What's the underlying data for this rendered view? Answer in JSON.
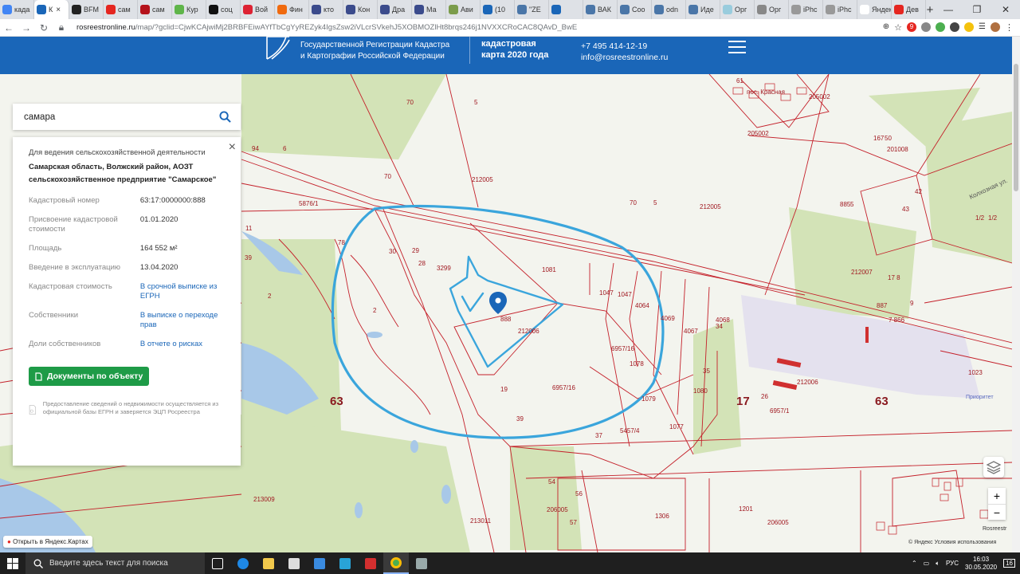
{
  "browser": {
    "tabs": [
      {
        "label": "када",
        "color": "#4285f4"
      },
      {
        "label": "К",
        "color": "#1a66b8",
        "active": true
      },
      {
        "label": "BFM",
        "color": "#222"
      },
      {
        "label": "сам",
        "color": "#e52620"
      },
      {
        "label": "сам",
        "color": "#b5121b"
      },
      {
        "label": "Кур",
        "color": "#5fb54a"
      },
      {
        "label": "соц",
        "color": "#111"
      },
      {
        "label": "Вой",
        "color": "#d23"
      },
      {
        "label": "Фин",
        "color": "#f06a0f"
      },
      {
        "label": "кто",
        "color": "#3b4b8c"
      },
      {
        "label": "Кон",
        "color": "#3b4b8c"
      },
      {
        "label": "Дра",
        "color": "#3b4b8c"
      },
      {
        "label": "Ма",
        "color": "#3b4b8c"
      },
      {
        "label": "Ави",
        "color": "#7b9c4b"
      },
      {
        "label": "(10",
        "color": "#1a66b8"
      },
      {
        "label": "\"ZE",
        "color": "#4a76a8"
      },
      {
        "label": "",
        "color": "#1a66b8"
      },
      {
        "label": "ВАК",
        "color": "#4a76a8"
      },
      {
        "label": "Coo",
        "color": "#4a76a8"
      },
      {
        "label": "odn",
        "color": "#4a76a8"
      },
      {
        "label": "Иде",
        "color": "#4a76a8"
      },
      {
        "label": "Орг",
        "color": "#9cd"
      },
      {
        "label": "Орг",
        "color": "#888"
      },
      {
        "label": "iPhc",
        "color": "#999"
      },
      {
        "label": "iPhc",
        "color": "#999"
      },
      {
        "label": "Яндекс",
        "color": "#fff"
      },
      {
        "label": "Дев",
        "color": "#e52620"
      }
    ],
    "new_tab": "+",
    "url_host": "rosreestronline.ru",
    "url_rest": "/map/?gclid=CjwKCAjwiMj2BRBFEiwAYfTbCgYyREZyk4IgsZsw2iVLcrSVkehJ5XOBMOZlHt8brqs246j1NVXXCRoCAC8QAvD_BwE",
    "badge": "9"
  },
  "header": {
    "org_line1": "Государственной Регистрации Кадастра",
    "org_line2": "и Картографии Российской Федерации",
    "map_line1": "кадастровая",
    "map_line2": "карта 2020 года",
    "phone": "+7 495 414-12-19",
    "email": "info@rosreestronline.ru"
  },
  "search": {
    "value": "самара"
  },
  "card": {
    "purpose": "Для ведения сельскохозяйственной деятельности",
    "address": "Самарская область, Волжский район, АОЗТ сельскохозяйственное предприятие \"Самарское\"",
    "rows": [
      {
        "k": "Кадастровый номер",
        "v": "63:17:0000000:888",
        "link": false
      },
      {
        "k": "Присвоение кадастровой стоимости",
        "v": "01.01.2020",
        "link": false
      },
      {
        "k": "Площадь",
        "v": "164 552 м²",
        "link": false
      },
      {
        "k": "Введение в эксплуатацию",
        "v": "13.04.2020",
        "link": false
      },
      {
        "k": "Кадастровая стоимость",
        "v": "В срочной выписке из ЕГРН",
        "link": true
      },
      {
        "k": "Собственники",
        "v": "В выписке о переходе прав",
        "link": true
      },
      {
        "k": "Доли собственников",
        "v": "В отчете о рисках",
        "link": true
      }
    ],
    "doc_button": "Документы по объекту",
    "note": "Предоставление сведений о недвижимости осуществляется из официальной базы ЕГРН и заверяется ЭЦП Росреестра"
  },
  "map": {
    "labels": [
      {
        "t": "70"
      },
      {
        "t": "5"
      },
      {
        "t": "94"
      },
      {
        "t": "6"
      },
      {
        "t": "70"
      },
      {
        "t": "212005"
      },
      {
        "t": "5876/1"
      },
      {
        "t": "70"
      },
      {
        "t": "5"
      },
      {
        "t": "212005"
      },
      {
        "t": "11"
      },
      {
        "t": "78"
      },
      {
        "t": "29"
      },
      {
        "t": "30"
      },
      {
        "t": "28"
      },
      {
        "t": "3299"
      },
      {
        "t": "1081"
      },
      {
        "t": "39"
      },
      {
        "t": "2"
      },
      {
        "t": "2"
      },
      {
        "t": "888"
      },
      {
        "t": "212006"
      },
      {
        "t": "1047"
      },
      {
        "t": "1047"
      },
      {
        "t": "4064"
      },
      {
        "t": "4069"
      },
      {
        "t": "4067"
      },
      {
        "t": "4068"
      },
      {
        "t": "34"
      },
      {
        "t": "6957/16"
      },
      {
        "t": "1078"
      },
      {
        "t": "35"
      },
      {
        "t": "6957/16"
      },
      {
        "t": "1079"
      },
      {
        "t": "1080"
      },
      {
        "t": "1077"
      },
      {
        "t": "5457/4"
      },
      {
        "t": "37"
      },
      {
        "t": "39"
      },
      {
        "t": "19"
      },
      {
        "t": "63"
      },
      {
        "t": "17"
      },
      {
        "t": "63"
      },
      {
        "t": "212006"
      },
      {
        "t": "6957/1"
      },
      {
        "t": "26"
      },
      {
        "t": "205002"
      },
      {
        "t": "205002"
      },
      {
        "t": "61"
      },
      {
        "t": "167"
      },
      {
        "t": "50"
      },
      {
        "t": "201008"
      },
      {
        "t": "42"
      },
      {
        "t": "43"
      },
      {
        "t": "885"
      },
      {
        "t": "5"
      },
      {
        "t": "212007"
      },
      {
        "t": "17 8"
      },
      {
        "t": "887"
      },
      {
        "t": "9"
      },
      {
        "t": "7 866"
      },
      {
        "t": "1/2"
      },
      {
        "t": "1/2"
      },
      {
        "t": "1023"
      },
      {
        "t": "Приоритет"
      },
      {
        "t": "54"
      },
      {
        "t": "56"
      },
      {
        "t": "206005"
      },
      {
        "t": "57"
      },
      {
        "t": "213011"
      },
      {
        "t": "1306"
      },
      {
        "t": "1201"
      },
      {
        "t": "206005"
      },
      {
        "t": "213009"
      },
      {
        "t": "Колхозная ул."
      },
      {
        "t": "пос. Красная"
      }
    ],
    "open_yandex": "Открыть в Яндекс.Картах",
    "copyright": "© Яндекс Условия использования",
    "rosreestr": "Rosreestr",
    "zoom_in": "+",
    "zoom_out": "−"
  },
  "taskbar": {
    "search_placeholder": "Введите здесь текст для поиска",
    "lang": "РУС",
    "time": "16:03",
    "date": "30.05.2020",
    "notif": "16"
  }
}
